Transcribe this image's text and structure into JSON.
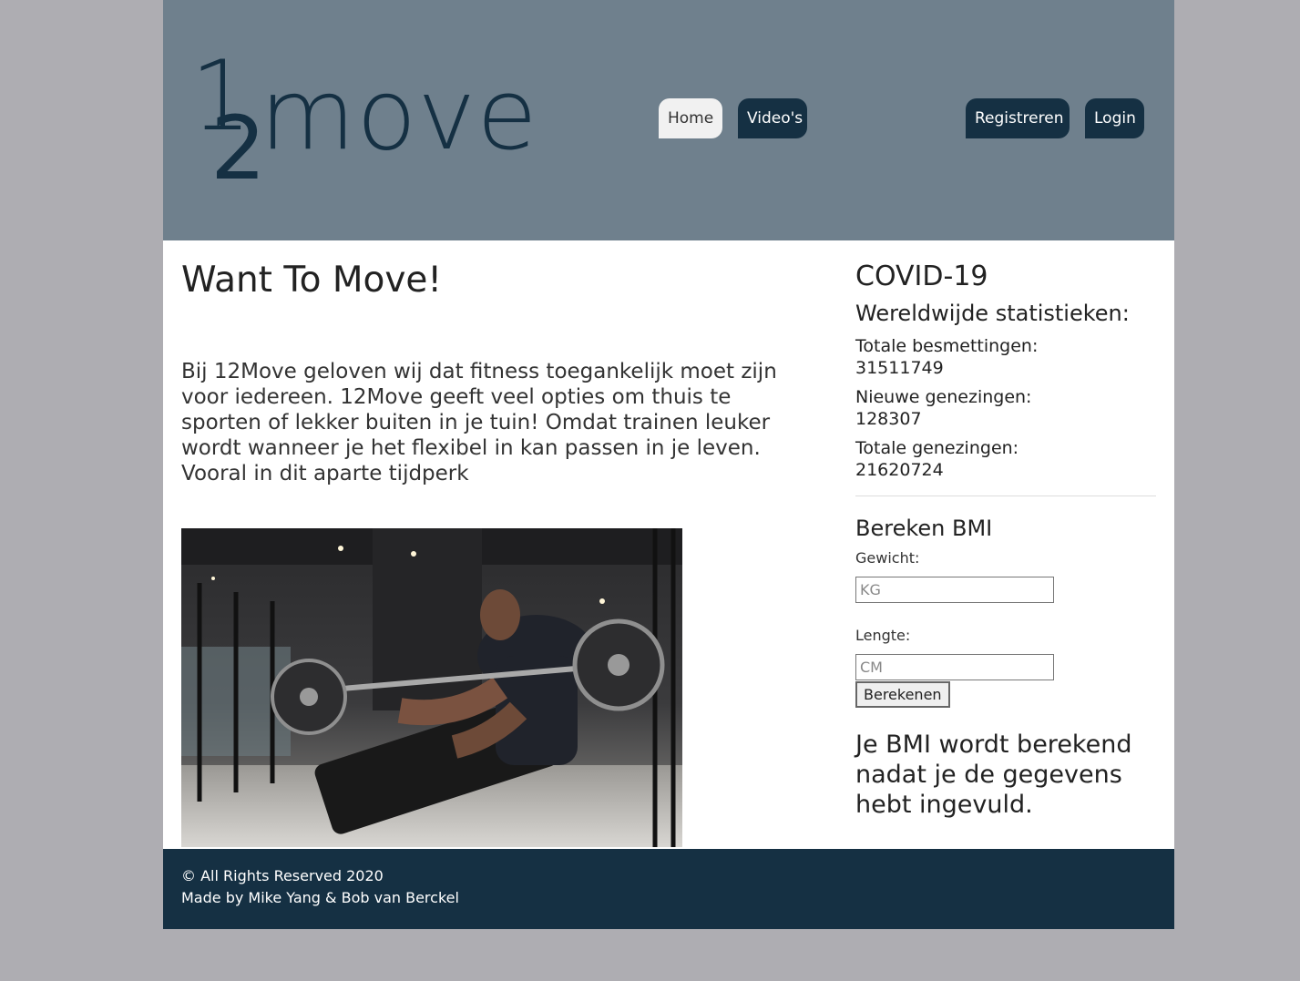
{
  "brand": {
    "logo_one": "1",
    "logo_two": "2",
    "logo_word": "move",
    "color": "#153043"
  },
  "nav": {
    "home": "Home",
    "videos": "Video's",
    "register": "Registreren",
    "login": "Login"
  },
  "main": {
    "title": "Want To Move!",
    "intro": "Bij 12Move geloven wij dat fitness toegankelijk moet zijn voor iedereen. 12Move geeft veel opties om thuis te sporten of lekker buiten in je tuin! Omdat trainen leuker wordt wanneer je het flexibel in kan passen in je leven. Vooral in dit aparte tijdperk",
    "image_icon": "gym-photo"
  },
  "covid": {
    "title": "COVID-19",
    "subtitle": "Wereldwijde statistieken:",
    "total_infections_label": "Totale besmettingen:",
    "total_infections_value": "31511749",
    "new_recoveries_label": "Nieuwe genezingen:",
    "new_recoveries_value": "128307",
    "total_recoveries_label": "Totale genezingen:",
    "total_recoveries_value": "21620724"
  },
  "bmi": {
    "title": "Bereken BMI",
    "weight_label": "Gewicht:",
    "weight_placeholder": "KG",
    "weight_value": "",
    "height_label": "Lengte:",
    "height_placeholder": "CM",
    "height_value": "",
    "button": "Berekenen",
    "result": "Je BMI wordt berekend nadat je de gegevens hebt ingevuld."
  },
  "footer": {
    "copyright": "© All Rights Reserved 2020",
    "credits": "Made by Mike Yang & Bob van Berckel"
  },
  "colors": {
    "header_bg": "#6f808d",
    "accent": "#153043",
    "page_bg": "#aeadb2"
  }
}
